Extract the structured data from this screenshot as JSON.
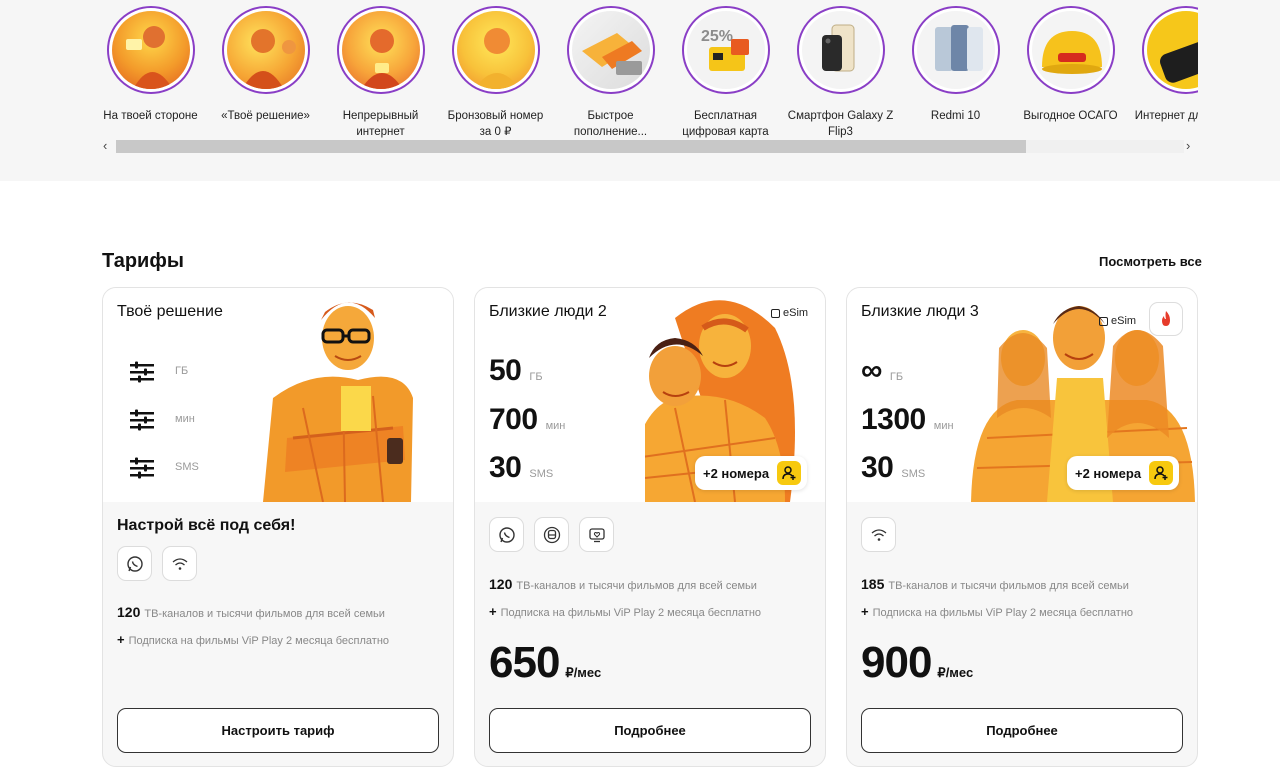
{
  "stories": {
    "items": [
      {
        "label": "На твоей стороне"
      },
      {
        "label": "«Твоё решение»"
      },
      {
        "label": "Непрерывный интернет"
      },
      {
        "label": "Бронзовый номер за 0 ₽"
      },
      {
        "label": "Быстрое пополнение..."
      },
      {
        "label": "Бесплатная цифровая карта",
        "badge": "25%"
      },
      {
        "label": "Смартфон Galaxy Z Flip3"
      },
      {
        "label": "Redmi 10"
      },
      {
        "label": "Выгодное ОСАГО"
      },
      {
        "label": "Интернет для дачи"
      }
    ],
    "scroll_left": "‹",
    "scroll_right": "›"
  },
  "tariffs": {
    "title": "Тарифы",
    "see_all": "Посмотреть все",
    "cards": [
      {
        "name": "Твоё решение",
        "units": [
          "ГБ",
          "мин",
          "SMS"
        ],
        "subtitle": "Настрой всё под себя!",
        "tv_count": "120",
        "tv_text": "ТВ-каналов и тысячи фильмов для всей семьи",
        "vip_plus": "+",
        "vip_text": "Подписка на фильмы ViP Play 2 месяца бесплатно",
        "button": "Настроить тариф"
      },
      {
        "name": "Близкие люди 2",
        "esim": "eSim",
        "stats": [
          {
            "value": "50",
            "unit": "ГБ"
          },
          {
            "value": "700",
            "unit": "мин"
          },
          {
            "value": "30",
            "unit": "SMS"
          }
        ],
        "plus_numbers": "+2 номера",
        "tv_count": "120",
        "tv_text": "ТВ-каналов и тысячи фильмов для всей семьи",
        "vip_plus": "+",
        "vip_text": "Подписка на фильмы ViP Play 2 месяца бесплатно",
        "price": "650",
        "price_unit": "₽/мес",
        "button": "Подробнее"
      },
      {
        "name": "Близкие люди 3",
        "esim": "eSim",
        "stats": [
          {
            "value": "∞",
            "unit": "ГБ"
          },
          {
            "value": "1300",
            "unit": "мин"
          },
          {
            "value": "30",
            "unit": "SMS"
          }
        ],
        "plus_numbers": "+2 номера",
        "tv_count": "185",
        "tv_text": "ТВ-каналов и тысячи фильмов для всей семьи",
        "vip_plus": "+",
        "vip_text": "Подписка на фильмы ViP Play 2 месяца бесплатно",
        "price": "900",
        "price_unit": "₽/мес",
        "button": "Подробнее"
      }
    ]
  },
  "colors": {
    "accent_yellow": "#f7c90f",
    "story_ring": "#8a3ec6",
    "photo_warm": "#f28b1f"
  }
}
